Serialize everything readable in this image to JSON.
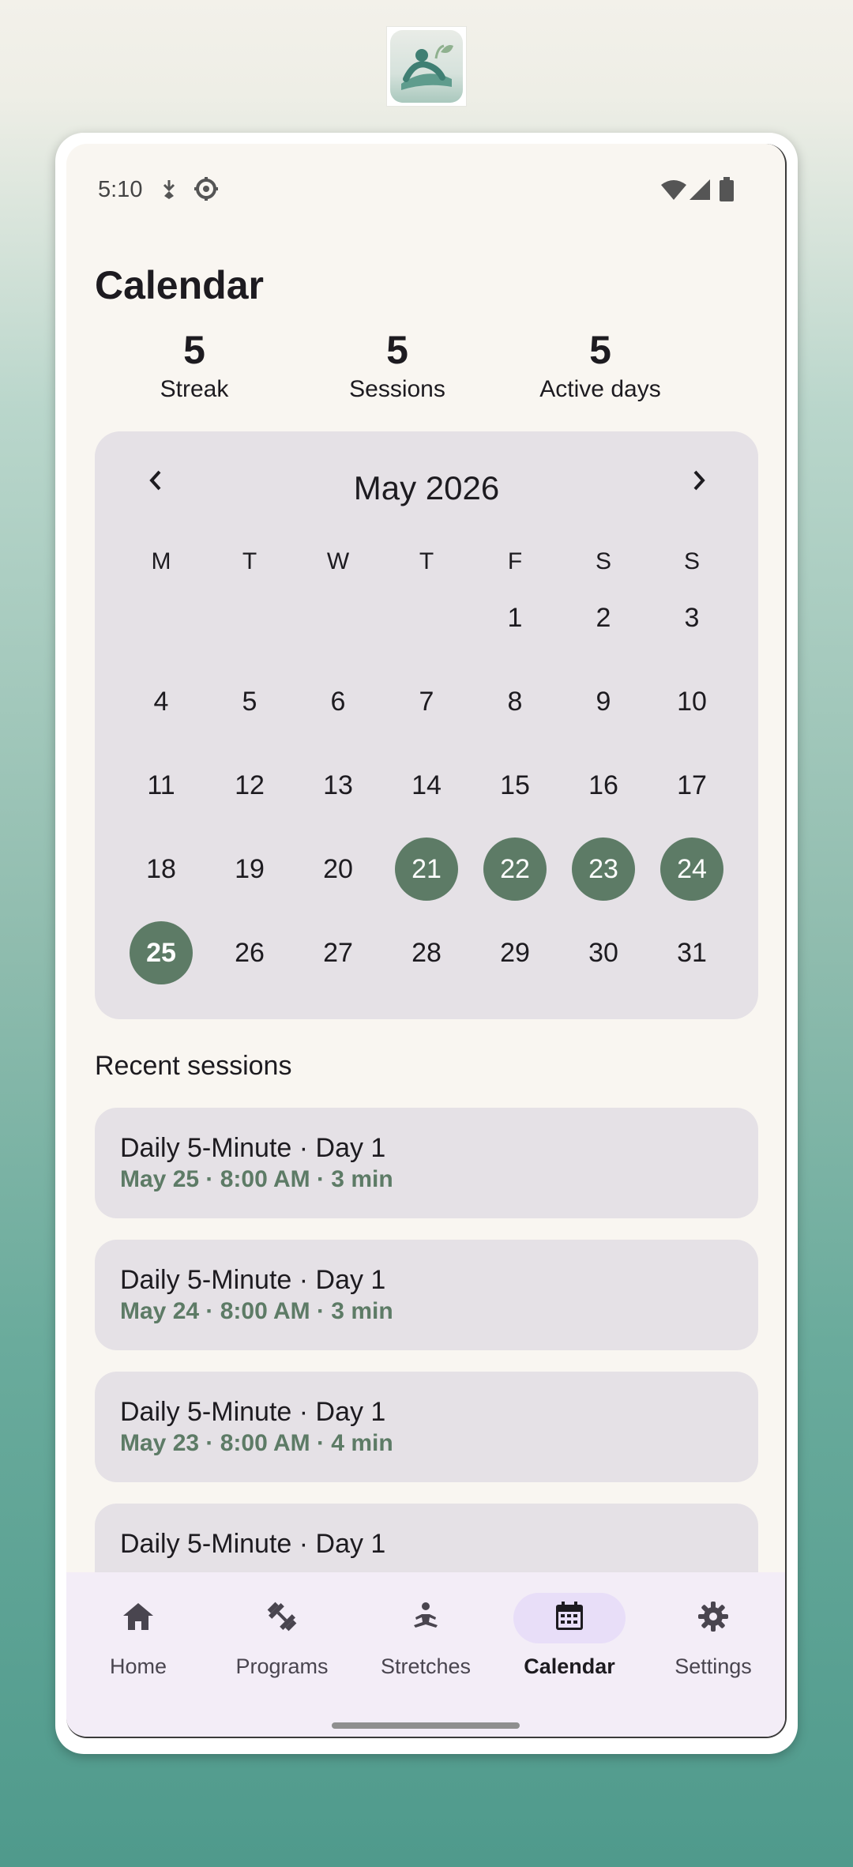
{
  "status_bar": {
    "time": "5:10"
  },
  "header": {
    "title": "Calendar"
  },
  "stats": [
    {
      "value": "5",
      "label": "Streak"
    },
    {
      "value": "5",
      "label": "Sessions"
    },
    {
      "value": "5",
      "label": "Active days"
    }
  ],
  "calendar": {
    "month_label": "May 2026",
    "weekdays": [
      "M",
      "T",
      "W",
      "T",
      "F",
      "S",
      "S"
    ],
    "days": [
      "1",
      "2",
      "3",
      "4",
      "5",
      "6",
      "7",
      "8",
      "9",
      "10",
      "11",
      "12",
      "13",
      "14",
      "15",
      "16",
      "17",
      "18",
      "19",
      "20",
      "21",
      "22",
      "23",
      "24",
      "25",
      "26",
      "27",
      "28",
      "29",
      "30",
      "31"
    ],
    "active_days": [
      "21",
      "22",
      "23",
      "24",
      "25"
    ],
    "highlight_color": "#5d7b66"
  },
  "recent": {
    "title": "Recent sessions",
    "sessions": [
      {
        "title": "Daily 5-Minute · Day 1",
        "detail": "May 25 · 8:00 AM · 3 min"
      },
      {
        "title": "Daily 5-Minute · Day 1",
        "detail": "May 24 · 8:00 AM · 3 min"
      },
      {
        "title": "Daily 5-Minute · Day 1",
        "detail": "May 23 · 8:00 AM · 4 min"
      },
      {
        "title": "Daily 5-Minute · Day 1",
        "detail": ""
      }
    ]
  },
  "nav": {
    "items": [
      {
        "label": "Home",
        "icon": "home-icon"
      },
      {
        "label": "Programs",
        "icon": "dumbbell-icon"
      },
      {
        "label": "Stretches",
        "icon": "meditation-icon"
      },
      {
        "label": "Calendar",
        "icon": "calendar-icon",
        "selected": true
      },
      {
        "label": "Settings",
        "icon": "gear-icon"
      }
    ]
  }
}
